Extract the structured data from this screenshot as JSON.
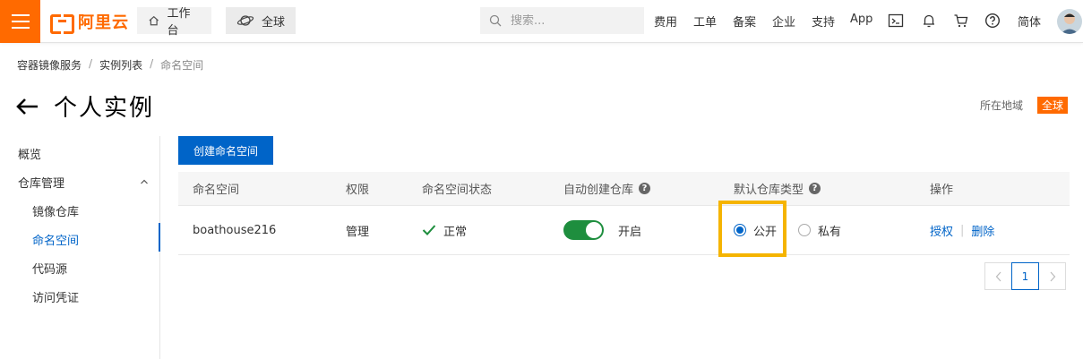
{
  "topbar": {
    "logo_text": "阿里云",
    "workbench_label": "工作台",
    "global_label": "全球",
    "search_placeholder": "搜索...",
    "links": [
      "费用",
      "工单",
      "备案",
      "企业",
      "支持",
      "App"
    ],
    "language_label": "简体",
    "icons": [
      "terminal-icon",
      "bell-icon",
      "cart-icon",
      "help-circle-icon"
    ]
  },
  "breadcrumb": {
    "items": [
      "容器镜像服务",
      "实例列表"
    ],
    "current": "命名空间"
  },
  "page": {
    "title": "个人实例",
    "region_label": "所在地域",
    "region_value": "全球"
  },
  "sidebar": {
    "overview": "概览",
    "repo_mgmt": "仓库管理",
    "items": [
      "镜像仓库",
      "命名空间",
      "代码源",
      "访问凭证"
    ],
    "active": "命名空间"
  },
  "main": {
    "create_button": "创建命名空间",
    "columns": [
      "命名空间",
      "权限",
      "命名空间状态",
      "自动创建仓库",
      "默认仓库类型",
      "操作"
    ],
    "rows": [
      {
        "namespace": "boathouse216",
        "permission": "管理",
        "status": "正常",
        "auto_create": "开启",
        "auto_create_on": true,
        "repo_type_public": "公开",
        "repo_type_private": "私有",
        "repo_type_selected": "公开",
        "op_authorize": "授权",
        "op_delete": "删除"
      }
    ],
    "pagination": {
      "current": "1"
    }
  },
  "colors": {
    "brand": "#ff6a00",
    "primary": "#0064c8",
    "toggle_on": "#1e8e3e",
    "highlight": "#f5b400"
  }
}
